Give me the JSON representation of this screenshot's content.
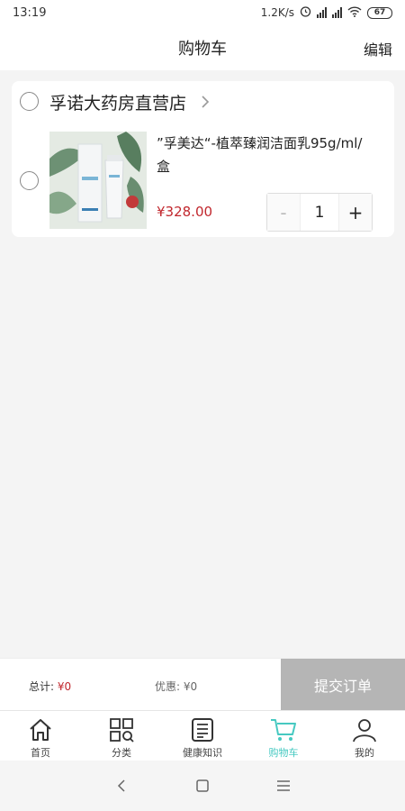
{
  "status_bar": {
    "time": "13:19",
    "net_speed": "1.2K/s",
    "battery": "67"
  },
  "header": {
    "title": "购物车",
    "edit_label": "编辑"
  },
  "store": {
    "name": "孚诺大药房直营店",
    "item": {
      "title": "”孚美达“-植萃臻润洁面乳95g/ml/盒",
      "price": "¥328.00",
      "quantity": "1",
      "minus_label": "-",
      "plus_label": "+"
    }
  },
  "checkout": {
    "total_label": "总计:",
    "total_value": "¥0",
    "discount_label": "优惠:",
    "discount_value": "¥0",
    "submit_label": "提交订单"
  },
  "tabs": [
    {
      "label": "首页",
      "icon": "home-icon"
    },
    {
      "label": "分类",
      "icon": "category-icon"
    },
    {
      "label": "健康知识",
      "icon": "article-icon"
    },
    {
      "label": "购物车",
      "icon": "cart-icon",
      "active": true
    },
    {
      "label": "我的",
      "icon": "profile-icon"
    }
  ],
  "colors": {
    "accent": "#46c9c1",
    "price": "#c1272d",
    "submit_disabled": "#b5b5b5"
  }
}
